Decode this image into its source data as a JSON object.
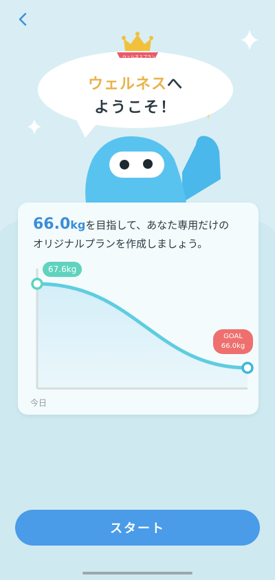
{
  "nav": {
    "back_icon": "chevron-left-icon"
  },
  "hero": {
    "ribbon_text": "ウェルネスプラン",
    "title_highlight": "ウェルネス",
    "title_rest": "へ",
    "title_line2": "ようこそ！"
  },
  "card": {
    "weight_value": "66.0",
    "weight_unit": "kg",
    "message_line1": "を目指して、あなた専用だけの",
    "message_line2": "オリジナルプランを作成しましょう。",
    "start_label": "67.6kg",
    "goal_label": "GOAL",
    "goal_value": "66.0kg",
    "today_label": "今日"
  },
  "chart_data": {
    "type": "line",
    "x": [
      "今日",
      "GOAL"
    ],
    "series": [
      {
        "values": [
          67.6,
          66.0
        ]
      }
    ]
  },
  "footer": {
    "start_button": "スタート"
  },
  "colors": {
    "accent": "#4a9be8",
    "curve": "#5fd3be",
    "goal": "#ef6f6f",
    "title_highlight": "#e9b24a"
  }
}
